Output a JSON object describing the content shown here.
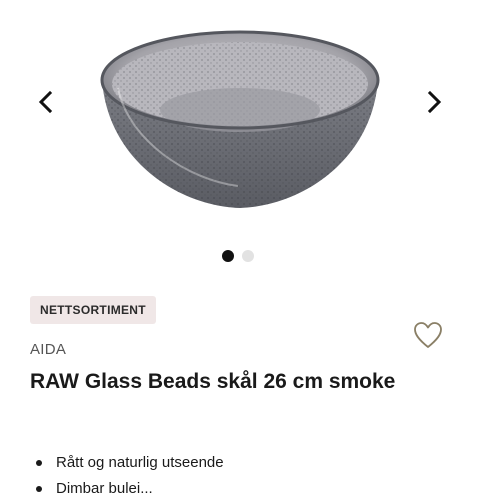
{
  "carousel": {
    "prev_label": "previous image",
    "next_label": "next image",
    "slide_count": 2,
    "active_slide": 1
  },
  "product": {
    "badge": "NETTSORTIMENT",
    "brand": "AIDA",
    "title": "RAW Glass Beads skål 26 cm smoke",
    "features": [
      "Rått og naturlig utseende",
      "Dimbar bulei..."
    ]
  },
  "icons": {
    "prev": "chevron-left-icon",
    "next": "chevron-right-icon",
    "wishlist": "heart-outline-icon"
  },
  "colors": {
    "badge_bg": "#f0e7e7",
    "dot_active": "#111111",
    "dot_inactive": "#e2e2e2",
    "heart_stroke": "#8a7f66",
    "bowl_glass": "#5f636b"
  }
}
